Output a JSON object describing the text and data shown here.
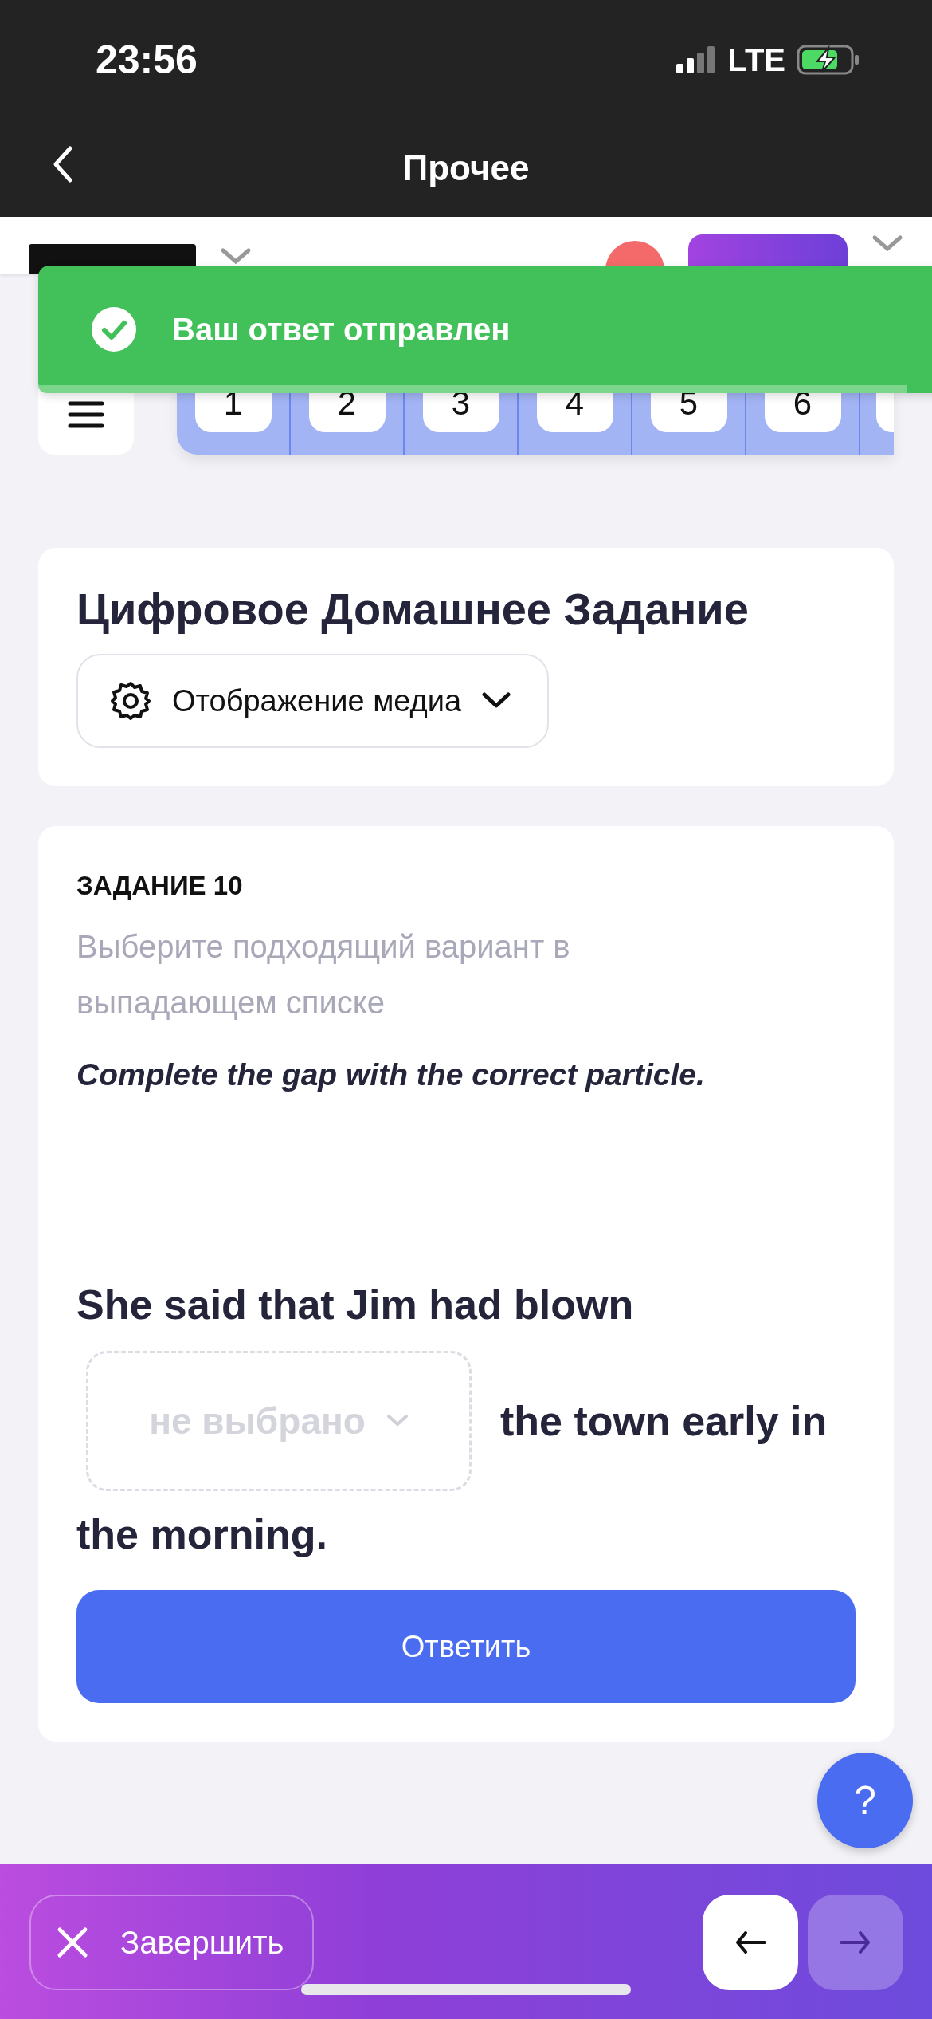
{
  "status_bar": {
    "time": "23:56",
    "network": "LTE"
  },
  "nav": {
    "title": "Прочее"
  },
  "toast": {
    "message": "Ваш ответ отправлен",
    "level": 0.94
  },
  "question_nav": {
    "items": [
      {
        "label": "1"
      },
      {
        "label": "2"
      },
      {
        "label": "3"
      },
      {
        "label": "4"
      },
      {
        "label": "5"
      },
      {
        "label": "6"
      }
    ]
  },
  "homework_card": {
    "title": "Цифровое Домашнее Задание",
    "media_button": "Отображение медиа"
  },
  "task": {
    "number": "ЗАДАНИЕ 10",
    "instruction": "Выберите подходящий вариант в выпадающем списке",
    "prompt": "Complete the gap with the correct particle.",
    "sentence_before": "She said that Jim had blown",
    "gap": {
      "placeholder": "не выбрано"
    },
    "sentence_after": [
      "the town early in",
      "the morning."
    ],
    "submit_button": "Ответить"
  },
  "help_button": "?",
  "bottom_bar": {
    "finish_button": "Завершить",
    "back_disabled": false,
    "next_disabled": true
  }
}
